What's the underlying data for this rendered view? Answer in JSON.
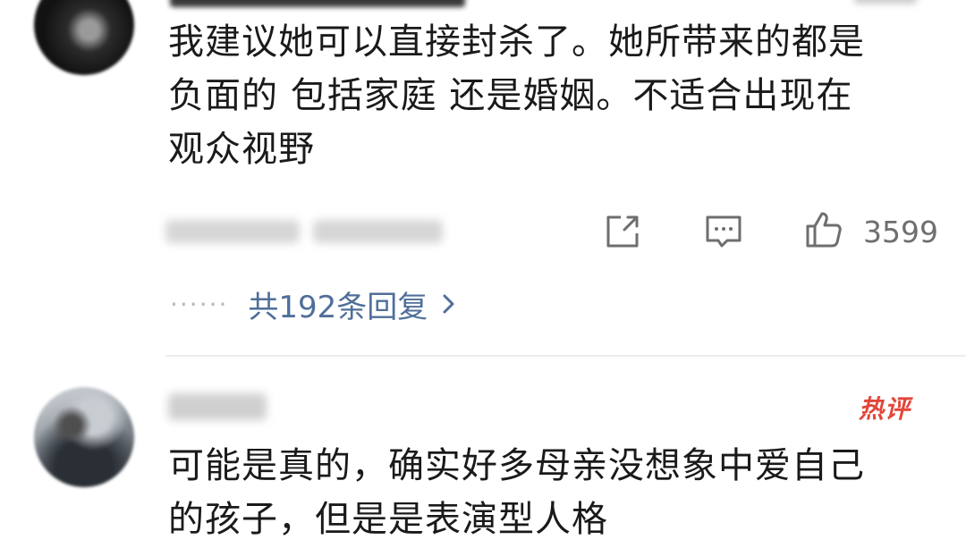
{
  "comments": [
    {
      "text": "我建议她可以直接封杀了。她所带来的都是\n负面的 包括家庭 还是婚姻。不适合出现在\n观众视野",
      "like_count": "3599",
      "replies_label": "共192条回复",
      "replies_dots": "······"
    },
    {
      "badge": "热评",
      "text": "可能是真的，确实好多母亲没想象中爱自己\n的孩子，但是是表演型人格"
    }
  ],
  "colors": {
    "link": "#4f6f9a",
    "hot_badge": "#e2463a",
    "meta_gray": "#6e6e6e"
  },
  "icons": [
    "share-icon",
    "comment-reply-icon",
    "thumbs-up-icon",
    "chevron-right-icon"
  ]
}
